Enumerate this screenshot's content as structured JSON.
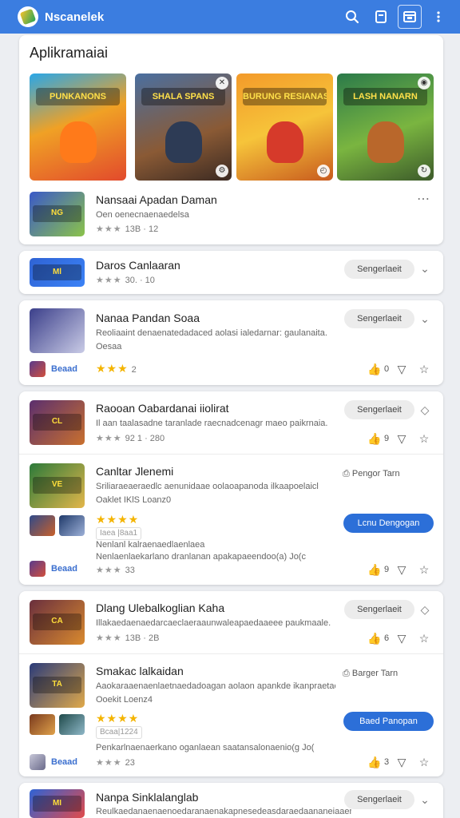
{
  "topbar": {
    "title": "Nscanelek",
    "icons": [
      "search-icon",
      "bookmark-icon",
      "calendar-icon",
      "more-vert-icon"
    ]
  },
  "featured": {
    "section_title": "Aplikramaiai",
    "tiles": [
      {
        "label": "PUNKANONS",
        "icon": "game-tile-icon"
      },
      {
        "label": "SHALA SPANS",
        "icon": "game-tile-icon"
      },
      {
        "label": "BURUNG RESIANAS",
        "icon": "game-tile-icon"
      },
      {
        "label": "LASH NANARN",
        "icon": "game-tile-icon"
      }
    ],
    "app": {
      "title": "Nansaai Apadan Daman",
      "desc": "Oen oenecnaenaedelsa",
      "stars": "★★★",
      "rating": "13B",
      "meta": "12",
      "more": "⋯"
    }
  },
  "rows": [
    {
      "title": "Daros Canlaaran",
      "stars": "★★★",
      "rating": "30.",
      "meta": "10",
      "button": "Sengerlaeit",
      "chevron": "⌄"
    },
    {
      "title": "Nanaa Pandan Soaa",
      "desc": "Reoliaaint denaenatedadaced aolasi ialedarnar: gaulanaita.",
      "desc2": "Oesaa",
      "stars": "★★★",
      "rating": "2",
      "button": "Sengerlaeit",
      "chevron": "⌄",
      "small_label": "Beaad",
      "likes": "0"
    }
  ],
  "group1": {
    "item1": {
      "title": "Raooan Oabardanai iiolirat",
      "desc": "Il aan taalasadne taranlade raecnadcenagr maeo paikrnaia.",
      "stars": "★★★",
      "rating": "92 1",
      "meta": "280",
      "button": "Sengerlaeit",
      "likes": "9"
    },
    "item2": {
      "title": "Canltar Jlenemi",
      "desc": "Sriliaraeaeraedlc aenunidaae oolaoapanoda ilkaapoelaicl",
      "desc2": "Oaklet IKlS   Loanz0",
      "stars": "★★★★",
      "tag": "Iaea |8aa1",
      "body1": "Nenlanl kalraenaedlaenlaea",
      "body2": "Nenlaenlaekarlano dranlanan apakapaeendoo(a) Jo(c",
      "link": "Pengor Tarn",
      "button": "Lcnu Dengogan",
      "small_label": "Beaad",
      "stars2": "★★★",
      "rating2": "33",
      "likes": "9"
    }
  },
  "group2": {
    "item1": {
      "title": "Dlang Ulebalkoglian Kaha",
      "desc": "Illakaedaenaedarcaeclaeraaunwaleapaedaaeee paukmaale.",
      "stars": "★★★",
      "rating": "13B",
      "meta": "2B",
      "button": "Sengerlaeit",
      "likes": "6"
    },
    "item2": {
      "title": "Smakac lalkaidan",
      "desc": "Aaokaraaenaenlaetnaedadoagan aolaon apankde ikanpraetaolel",
      "desc2": "Ooekit   Loenz4",
      "stars": "★★★★",
      "tag": "Bcaa|1224",
      "body": "Penkarlnaenaerkano oganlaean saatansalonaenio(g Jo(",
      "link": "Barger Tarn",
      "button": "Baed Panopan",
      "small_label": "Beaad",
      "stars2": "★★★",
      "rating2": "23",
      "likes": "3"
    }
  },
  "bottom": {
    "title": "Nanpa Sinklalanglab",
    "desc": "Reulkaedanaenaenoedaranaenakapnesedeasdaraedaananeiaaene.",
    "button": "Sengerlaeit",
    "chevron": "⌄"
  }
}
